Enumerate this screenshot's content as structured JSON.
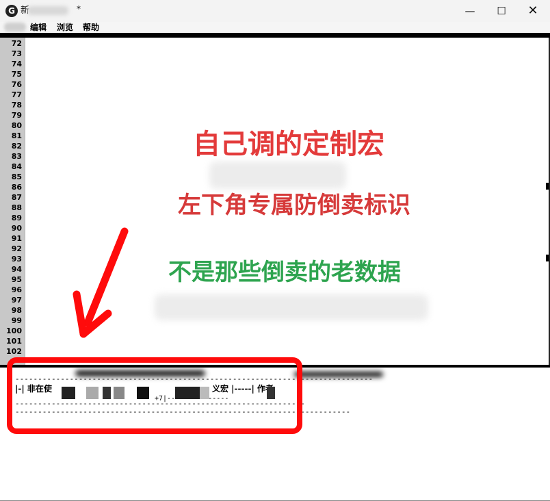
{
  "window": {
    "title": "新",
    "modified_mark": "*",
    "icon": "app-logo-icon",
    "controls": {
      "minimize": "—",
      "maximize": "☐",
      "close": "✕"
    }
  },
  "menu": {
    "items": [
      "编辑",
      "浏览",
      "帮助"
    ]
  },
  "editor": {
    "line_numbers": [
      "72",
      "73",
      "74",
      "75",
      "76",
      "77",
      "78",
      "79",
      "80",
      "81",
      "82",
      "83",
      "84",
      "85",
      "86",
      "87",
      "88",
      "89",
      "90",
      "91",
      "92",
      "93",
      "94",
      "95",
      "96",
      "97",
      "98",
      "99",
      "100",
      "101",
      "102"
    ]
  },
  "output_panel": {
    "dash_line_1": "-------------------------------------------------------------------------------",
    "status_text": "|-| 非在使",
    "macro_text": "义宏 |-----| 作者",
    "small_number": "+7|---------------",
    "dash_line_2": "----------------------------------------------------------------",
    "dash_line_3": "--------------------------------------------------------------------------"
  },
  "overlay": {
    "headline": "自己调的定制宏",
    "subline": "左下角专属防倒卖标识",
    "note": "不是那些倒卖的老数据"
  },
  "colors": {
    "annotation_red": "#ff0b0b",
    "headline_red": "#e33b3b",
    "note_green": "#2ea44f",
    "gutter_gray": "#c8c8c8"
  }
}
